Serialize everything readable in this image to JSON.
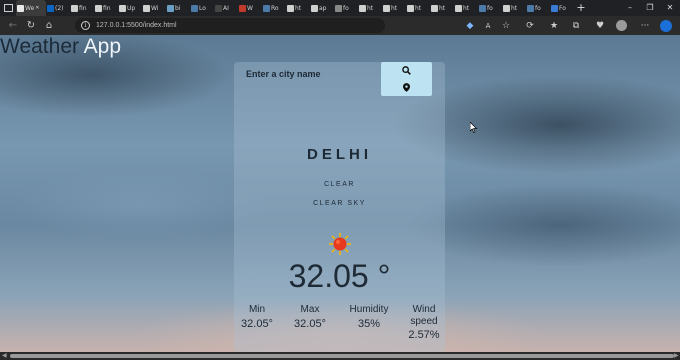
{
  "browser": {
    "tabs": [
      {
        "label": "We",
        "active": true,
        "color": "#e8e8e8"
      },
      {
        "label": "(2)",
        "color": "#0a66c2"
      },
      {
        "label": "fin",
        "color": "#d0d0d0"
      },
      {
        "label": "fin",
        "color": "#d0d0d0"
      },
      {
        "label": "Up",
        "color": "#d0d0d0"
      },
      {
        "label": "Wi",
        "color": "#cfcfcf"
      },
      {
        "label": "bi",
        "color": "#6aa0c8"
      },
      {
        "label": "Lo",
        "color": "#4a7aa8"
      },
      {
        "label": "AI",
        "color": "#444444"
      },
      {
        "label": "W",
        "color": "#c0392b"
      },
      {
        "label": "Ro",
        "color": "#4a7aa8"
      },
      {
        "label": "ht",
        "color": "#cfcfcf"
      },
      {
        "label": "ap",
        "color": "#cfcfcf"
      },
      {
        "label": "fo",
        "color": "#888888"
      },
      {
        "label": "ht",
        "color": "#cfcfcf"
      },
      {
        "label": "ht",
        "color": "#cfcfcf"
      },
      {
        "label": "ht",
        "color": "#cfcfcf"
      },
      {
        "label": "ht",
        "color": "#cfcfcf"
      },
      {
        "label": "ht",
        "color": "#cfcfcf"
      },
      {
        "label": "fo",
        "color": "#4a7aa8"
      },
      {
        "label": "ht",
        "color": "#cfcfcf"
      },
      {
        "label": "fo",
        "color": "#4a7aa8"
      },
      {
        "label": "Fo",
        "color": "#3a7bd5"
      }
    ],
    "url": "127.0.0.1:5500/index.html"
  },
  "app": {
    "title_part1": "Weather ",
    "title_part2": "App",
    "search_placeholder": "Enter a city name",
    "city": "DELHI",
    "condition": "CLEAR",
    "description": "CLEAR SKY",
    "temperature": "32.05 °",
    "stats": {
      "min_label": "Min",
      "min_value": "32.05°",
      "max_label": "Max",
      "max_value": "32.05°",
      "humidity_label": "Humidity",
      "humidity_value": "35%",
      "wind_label": "Wind speed",
      "wind_value": "2.57%"
    }
  },
  "colors": {
    "button_bg": "#bde3f3",
    "text_dark": "#1d2a36",
    "title_light": "#eef4f8"
  },
  "icons": [
    "back-icon",
    "refresh-icon",
    "home-icon",
    "info-icon",
    "search-icon",
    "location-pin-icon",
    "sun-icon"
  ]
}
